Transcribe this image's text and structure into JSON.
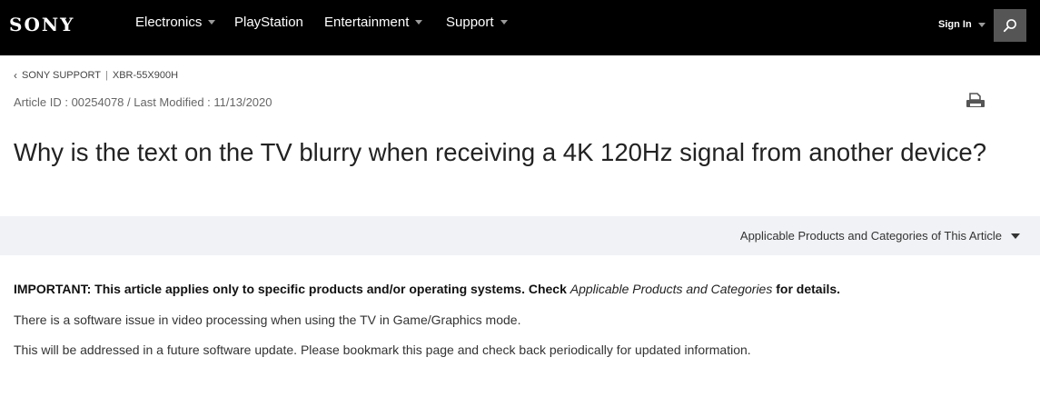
{
  "header": {
    "logo": "SONY",
    "nav": [
      {
        "label": "Electronics",
        "has_dropdown": true
      },
      {
        "label": "PlayStation",
        "has_dropdown": false
      },
      {
        "label": "Entertainment",
        "has_dropdown": true
      },
      {
        "label": "Support",
        "has_dropdown": true
      }
    ],
    "signin_label": "Sign In",
    "search_icon": "search-icon"
  },
  "breadcrumb": {
    "items": [
      "SONY SUPPORT",
      "XBR-55X900H"
    ],
    "separator": "|"
  },
  "article": {
    "meta": "Article ID : 00254078 / Last Modified : 11/13/2020",
    "title": "Why is the text on the TV blurry when receiving a 4K 120Hz signal from another device?",
    "print_icon": "print-icon"
  },
  "products_bar": {
    "label": "Applicable Products and Categories of This Article"
  },
  "body": {
    "important_prefix": "IMPORTANT: This article applies only to specific products and/or operating systems. Check ",
    "important_link": "Applicable Products and Categories",
    "important_suffix": " for details.",
    "paragraphs": [
      "There is a software issue in video processing when using the TV in Game/Graphics mode.",
      "This will be addressed in a future software update. Please bookmark this page and check back periodically for updated information."
    ]
  },
  "colors": {
    "nav_bg": "#000000",
    "search_bg": "#555555",
    "products_bar_bg": "#f0f2f5",
    "text": "#333333"
  }
}
